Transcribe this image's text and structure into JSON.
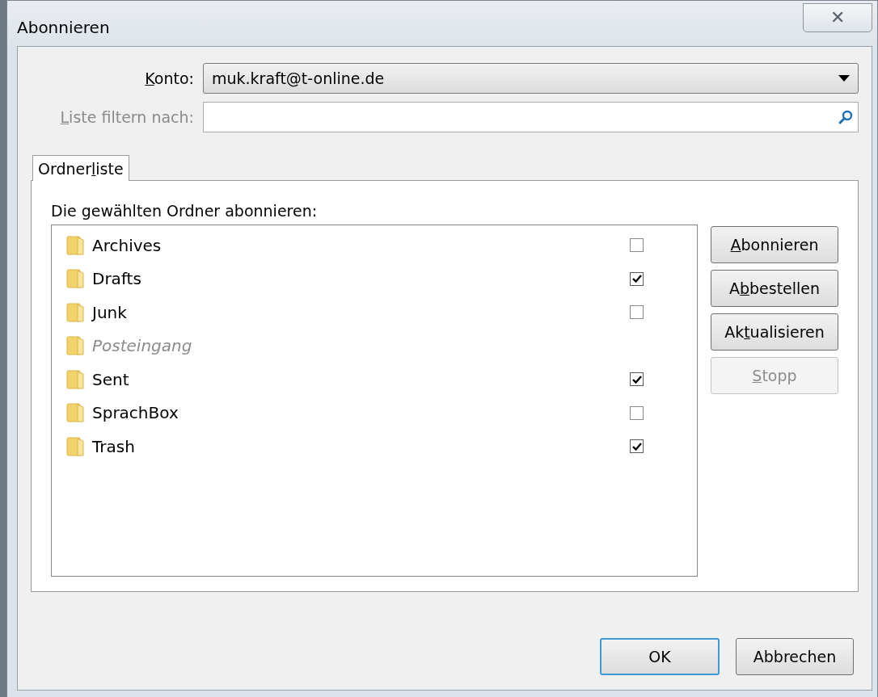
{
  "window": {
    "title": "Abonnieren",
    "close": "✕"
  },
  "account": {
    "label": [
      {
        "text": "K",
        "underline": true
      },
      {
        "text": "onto:",
        "underline": false
      }
    ],
    "value": "muk.kraft@t-online.de"
  },
  "filter": {
    "label": [
      {
        "text": "L",
        "underline": true
      },
      {
        "text": "iste filtern nach:",
        "underline": false
      }
    ],
    "disabled": true
  },
  "tabs": [
    {
      "label": [
        {
          "text": "Ordner",
          "underline": false
        },
        {
          "text": "l",
          "underline": true
        },
        {
          "text": "iste",
          "underline": false
        }
      ],
      "selected": true
    }
  ],
  "list": {
    "caption": "Die gewählten Ordner abonnieren:",
    "folders": [
      {
        "name": "Archives",
        "disabled": false,
        "checked": false
      },
      {
        "name": "Drafts",
        "disabled": false,
        "checked": true
      },
      {
        "name": "Junk",
        "disabled": false,
        "checked": false
      },
      {
        "name": "Posteingang",
        "disabled": true
      },
      {
        "name": "Sent",
        "disabled": false,
        "checked": true
      },
      {
        "name": "SprachBox",
        "disabled": false,
        "checked": false
      },
      {
        "name": "Trash",
        "disabled": false,
        "checked": true
      }
    ]
  },
  "side_buttons": [
    {
      "label": [
        {
          "text": "A",
          "underline": true
        },
        {
          "text": "bonnieren",
          "underline": false
        }
      ],
      "disabled": false
    },
    {
      "label": [
        {
          "text": "A",
          "underline": false
        },
        {
          "text": "b",
          "underline": true
        },
        {
          "text": "bestellen",
          "underline": false
        }
      ],
      "disabled": false
    },
    {
      "label": [
        {
          "text": "Ak",
          "underline": false
        },
        {
          "text": "t",
          "underline": true
        },
        {
          "text": "ualisieren",
          "underline": false
        }
      ],
      "disabled": false
    },
    {
      "label": [
        {
          "text": "S",
          "underline": true
        },
        {
          "text": "topp",
          "underline": false
        }
      ],
      "disabled": true
    }
  ],
  "buttons": [
    {
      "label": "OK",
      "default": true
    },
    {
      "label": "Abbrechen",
      "default": false
    }
  ]
}
